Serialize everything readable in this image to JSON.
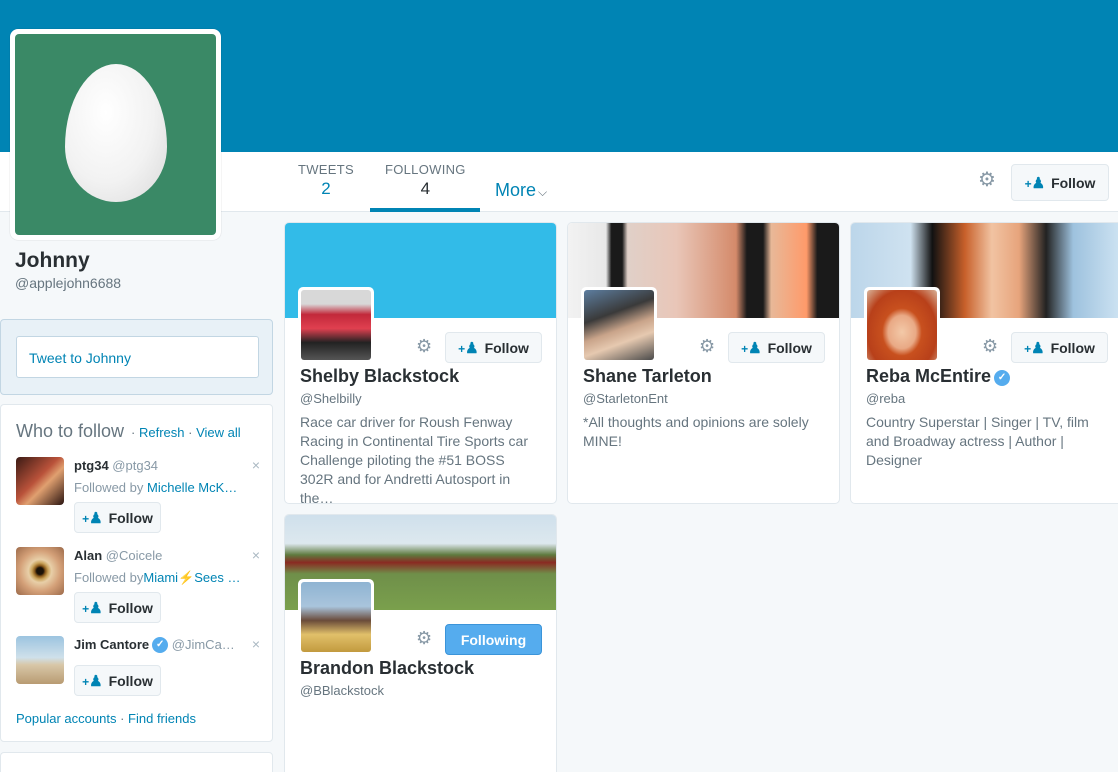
{
  "profile": {
    "name": "Johnny",
    "handle": "@applejohn6688"
  },
  "nav": {
    "tweets_label": "TWEETS",
    "tweets_count": "2",
    "following_label": "FOLLOWING",
    "following_count": "4",
    "more_label": "More",
    "follow_label": "Follow"
  },
  "tweet_to": {
    "text": "Tweet to Johnny"
  },
  "who_to_follow": {
    "title": "Who to follow",
    "sep": "·",
    "refresh": "Refresh",
    "view_all": "View all",
    "suggestions": [
      {
        "name": "ptg34",
        "handle": "@ptg34",
        "followed_by": "Followed by",
        "followed_name": "Michelle McK…",
        "button": "Follow",
        "close": "×"
      },
      {
        "name": "Alan",
        "handle": "@Coicele",
        "followed_by": "Followed by",
        "followed_name": "Miami⚡Sees …",
        "button": "Follow",
        "close": "×"
      },
      {
        "name": "Jim Cantore",
        "handle": "@JimCa…",
        "button": "Follow",
        "close": "×"
      }
    ],
    "popular_accounts": "Popular accounts",
    "find_friends": "Find friends"
  },
  "cards": [
    {
      "name": "Shelby Blackstock",
      "handle": "@Shelbilly",
      "bio": "Race car driver for Roush Fenway Racing in Continental Tire Sports car Challenge piloting the #51 BOSS 302R and for Andretti Autosport in the…",
      "button": "Follow"
    },
    {
      "name": "Shane Tarleton",
      "handle": "@StarletonEnt",
      "bio": "*All thoughts and opinions are solely MINE!",
      "button": "Follow"
    },
    {
      "name": "Reba McEntire",
      "handle": "@reba",
      "bio": "Country Superstar | Singer | TV, film and Broadway actress | Author | Designer",
      "button": "Follow"
    },
    {
      "name": "Brandon Blackstock",
      "handle": "@BBlackstock",
      "bio": "",
      "button": "Following"
    }
  ],
  "colors": {
    "banner": "#0084b4",
    "avatar_bg": "#3a8966",
    "link": "#0084b4",
    "following_button": "#55acee"
  },
  "icons": {
    "gear": "⚙",
    "chevron": "⌄",
    "add_user": "+👤",
    "verified": "✓"
  }
}
